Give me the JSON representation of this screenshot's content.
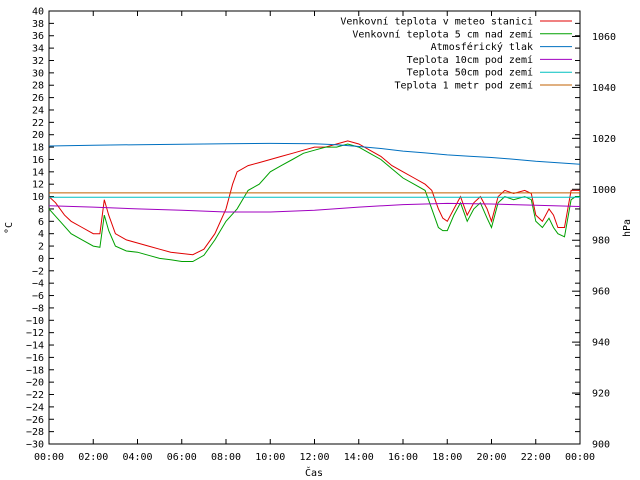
{
  "chart_data": {
    "type": "line",
    "xlabel": "Čas",
    "ylabel": "°C",
    "y2label": "hPa",
    "x_ticks": [
      "00:00",
      "02:00",
      "04:00",
      "06:00",
      "08:00",
      "10:00",
      "12:00",
      "14:00",
      "16:00",
      "18:00",
      "20:00",
      "22:00",
      "00:00"
    ],
    "xlim_hours": [
      0,
      24
    ],
    "ylim": [
      -30,
      40
    ],
    "y_ticks_step": 2,
    "y2lim": [
      900,
      1070
    ],
    "y2_ticks": [
      900,
      920,
      940,
      960,
      980,
      1000,
      1020,
      1040,
      1060
    ],
    "grid": false,
    "legend_position": "top-right",
    "series": [
      {
        "name": "Venkovní teplota v meteo stanici",
        "axis": "left",
        "color": "#e00000",
        "x": [
          0,
          0.3,
          0.7,
          1.0,
          1.5,
          2.0,
          2.3,
          2.5,
          2.7,
          3.0,
          3.5,
          4.0,
          4.5,
          5.0,
          5.5,
          6.0,
          6.5,
          7.0,
          7.5,
          8.0,
          8.3,
          8.5,
          9.0,
          9.5,
          10.0,
          10.5,
          11.0,
          11.5,
          12.0,
          12.5,
          13.0,
          13.5,
          14.0,
          14.5,
          15.0,
          15.5,
          16.0,
          16.5,
          17.0,
          17.3,
          17.6,
          17.8,
          18.0,
          18.3,
          18.6,
          18.9,
          19.2,
          19.5,
          19.8,
          20.0,
          20.3,
          20.6,
          21.0,
          21.5,
          21.8,
          22.0,
          22.3,
          22.6,
          22.8,
          23.0,
          23.3,
          23.6,
          23.8,
          24.0
        ],
        "values": [
          10,
          9,
          7,
          6,
          5,
          4,
          4,
          9.5,
          7,
          4,
          3,
          2.5,
          2,
          1.5,
          1,
          0.8,
          0.6,
          1.5,
          4,
          8,
          12,
          14,
          15,
          15.5,
          16,
          16.5,
          17,
          17.5,
          18,
          18,
          18.5,
          19,
          18.5,
          17.5,
          16.5,
          15,
          14,
          13,
          12,
          11,
          8,
          6.5,
          6,
          8,
          10,
          7,
          9,
          10,
          8,
          6,
          10,
          11,
          10.5,
          11,
          10.5,
          7,
          6,
          8,
          7,
          5,
          5,
          11,
          11,
          11
        ]
      },
      {
        "name": "Venkovní teplota 5 cm nad zemí",
        "axis": "left",
        "color": "#00a000",
        "x": [
          0,
          0.5,
          1.0,
          1.5,
          2.0,
          2.3,
          2.5,
          2.7,
          3.0,
          3.5,
          4.0,
          4.5,
          5.0,
          5.5,
          6.0,
          6.5,
          7.0,
          7.5,
          8.0,
          8.5,
          9.0,
          9.5,
          10.0,
          10.5,
          11.0,
          11.5,
          12.0,
          12.5,
          13.0,
          13.5,
          14.0,
          14.5,
          15.0,
          15.5,
          16.0,
          16.5,
          17.0,
          17.3,
          17.6,
          17.8,
          18.0,
          18.3,
          18.6,
          18.9,
          19.2,
          19.5,
          19.8,
          20.0,
          20.3,
          20.6,
          21.0,
          21.5,
          21.8,
          22.0,
          22.3,
          22.6,
          22.8,
          23.0,
          23.3,
          23.6,
          23.8,
          24.0
        ],
        "values": [
          8,
          6,
          4,
          3,
          2,
          1.8,
          7,
          4.5,
          2,
          1.2,
          1,
          0.5,
          0,
          -0.2,
          -0.5,
          -0.5,
          0.5,
          3,
          6,
          8,
          11,
          12,
          14,
          15,
          16,
          17,
          17.5,
          18,
          18,
          18.5,
          18,
          17,
          16,
          14.5,
          13,
          12,
          11,
          8,
          5,
          4.5,
          4.5,
          7,
          9,
          6,
          8,
          9,
          6.5,
          5,
          9,
          10,
          9.5,
          10,
          9.5,
          6,
          5,
          6.5,
          5,
          4,
          3.5,
          9.5,
          10,
          10
        ]
      },
      {
        "name": "Atmosférický tlak",
        "axis": "right",
        "color": "#0070c0",
        "x": [
          0,
          2,
          4,
          6,
          8,
          10,
          12,
          13,
          14,
          15,
          16,
          17,
          18,
          19,
          20,
          21,
          22,
          23,
          24
        ],
        "values": [
          1017,
          1017.3,
          1017.5,
          1017.7,
          1017.9,
          1018,
          1017.9,
          1017.5,
          1016.8,
          1016,
          1015,
          1014.3,
          1013.5,
          1013,
          1012.5,
          1011.8,
          1011,
          1010.4,
          1009.8
        ]
      },
      {
        "name": "Teplota 10cm pod zemí",
        "axis": "left",
        "color": "#a000c0",
        "x": [
          0,
          2,
          4,
          6,
          8,
          10,
          12,
          14,
          16,
          18,
          20,
          22,
          24
        ],
        "values": [
          8.5,
          8.3,
          8.0,
          7.8,
          7.5,
          7.5,
          7.8,
          8.3,
          8.7,
          8.9,
          8.8,
          8.6,
          8.4
        ]
      },
      {
        "name": "Teplota 50cm pod zemí",
        "axis": "left",
        "color": "#00c0c0",
        "x": [
          0,
          24
        ],
        "values": [
          9.9,
          9.9
        ]
      },
      {
        "name": "Teplota 1 metr pod zemí",
        "axis": "left",
        "color": "#c06000",
        "x": [
          0,
          24
        ],
        "values": [
          10.6,
          10.6
        ]
      }
    ]
  }
}
